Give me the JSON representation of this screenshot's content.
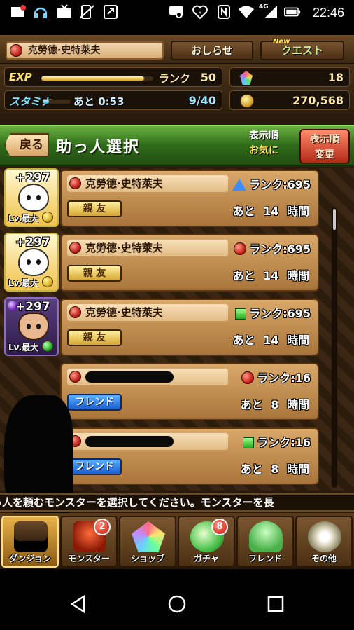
{
  "status_bar": {
    "time": "22:46",
    "network": "4G",
    "icons": [
      "notification-icon",
      "headphones-icon",
      "tv-icon",
      "signal-off-icon",
      "screenshot-icon",
      "cast-icon",
      "heart-icon",
      "nfc-icon",
      "wifi-icon",
      "signal-icon",
      "battery-icon"
    ]
  },
  "header": {
    "player_name": "克勞德·史特萊夫",
    "notice_label": "おしらせ",
    "quest_label": "クエスト",
    "quest_new_tag": "New"
  },
  "stats": {
    "exp_label": "EXP",
    "exp_progress": 0.92,
    "rank_label": "ランク",
    "rank_value": "50",
    "stamina_label": "スタミナ",
    "stamina_timer": "あと 0:53",
    "stamina_value": "9/40",
    "stamina_progress": 0.225,
    "magic_stones": "18",
    "coins": "270,568"
  },
  "title_bar": {
    "back_label": "戻る",
    "title": "助っ人選択",
    "sort_label_1": "表示順",
    "sort_label_2": "お気に",
    "sort_btn_1": "表示順",
    "sort_btn_2": "変更"
  },
  "helpers": [
    {
      "plus": "+297",
      "level": "Lv.最大",
      "name": "克勞德·史特萊夫",
      "tag": "親 友",
      "rank": "ランク:695",
      "rank_icon": "triangle-blue",
      "remain": "あと 14 時間"
    },
    {
      "plus": "+297",
      "level": "Lv.最大",
      "name": "克勞德·史特萊夫",
      "tag": "親 友",
      "rank": "ランク:695",
      "rank_icon": "circle-red",
      "remain": "あと 14 時間"
    },
    {
      "plus": "+297",
      "level": "Lv.最大",
      "name": "克勞德·史特萊夫",
      "tag": "親 友",
      "rank": "ランク:695",
      "rank_icon": "square-green",
      "remain": "あと 14 時間"
    },
    {
      "plus": "",
      "level": "",
      "name": "",
      "tag": "フレンド",
      "rank": "ランク:16",
      "rank_icon": "circle-red",
      "remain": "あと 8 時間"
    },
    {
      "plus": "",
      "level": "",
      "name": "",
      "tag": "フレンド",
      "rank": "ランク:16",
      "rank_icon": "square-green",
      "remain": "あと 8 時間"
    }
  ],
  "ticker": "っ人を頼むモンスターを選択してください。モンスターを長",
  "nav": [
    {
      "label": "ダンジョン",
      "icon": "dungeon-icon",
      "badge": ""
    },
    {
      "label": "モンスター",
      "icon": "monster-icon",
      "badge": "2"
    },
    {
      "label": "ショップ",
      "icon": "shop-icon",
      "badge": ""
    },
    {
      "label": "ガチャ",
      "icon": "gacha-icon",
      "badge": "8"
    },
    {
      "label": "フレンド",
      "icon": "friend-icon",
      "badge": ""
    },
    {
      "label": "その他",
      "icon": "other-icon",
      "badge": ""
    }
  ],
  "colors": {
    "title_green": "#2f6b1a",
    "card_tan": "#c8945a",
    "best_friend_gold": "#d6a630",
    "friend_blue": "#1a5ed0"
  }
}
